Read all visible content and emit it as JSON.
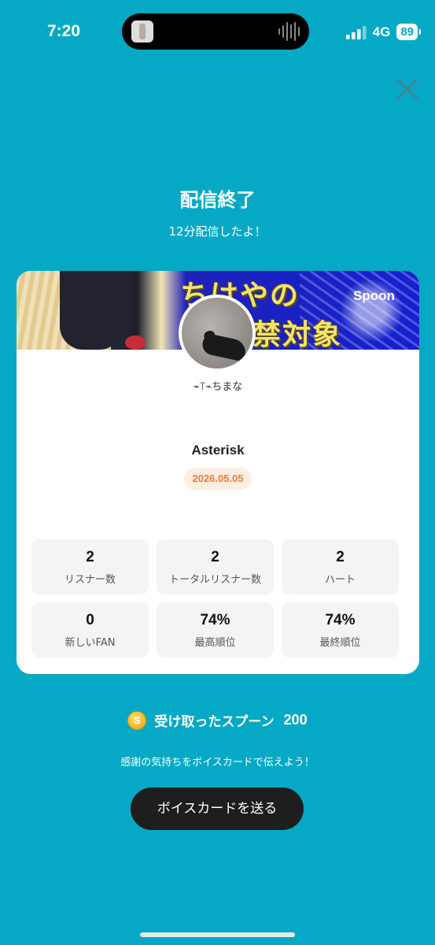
{
  "status_bar": {
    "time": "7:20",
    "network": "4G",
    "battery": "89"
  },
  "header": {
    "title": "配信終了",
    "subtitle": "12分配信したよ！"
  },
  "card": {
    "banner_text_line1": "ちはやの",
    "banner_text_line2": "禁対象",
    "banner_logo": "Spoon",
    "dj_name": "⌁⍑⌁ちまな",
    "show_title": "Asterisk",
    "date": "2026.05.05",
    "stats": [
      {
        "value": "2",
        "label": "リスナー数"
      },
      {
        "value": "2",
        "label": "トータルリスナー数"
      },
      {
        "value": "2",
        "label": "ハート"
      },
      {
        "value": "0",
        "label": "新しいFAN"
      },
      {
        "value": "74%",
        "label": "最高順位"
      },
      {
        "value": "74%",
        "label": "最終順位"
      }
    ]
  },
  "spoons": {
    "coin_symbol": "S",
    "label": "受け取ったスプーン",
    "count": "200"
  },
  "thanks_text": "感謝の気持ちをボイスカードで伝えよう！",
  "voice_card_button": "ボイスカードを送る",
  "colors": {
    "background": "#05a9c5",
    "date_badge_text": "#f07a3a",
    "button": "#1e1e1e"
  }
}
